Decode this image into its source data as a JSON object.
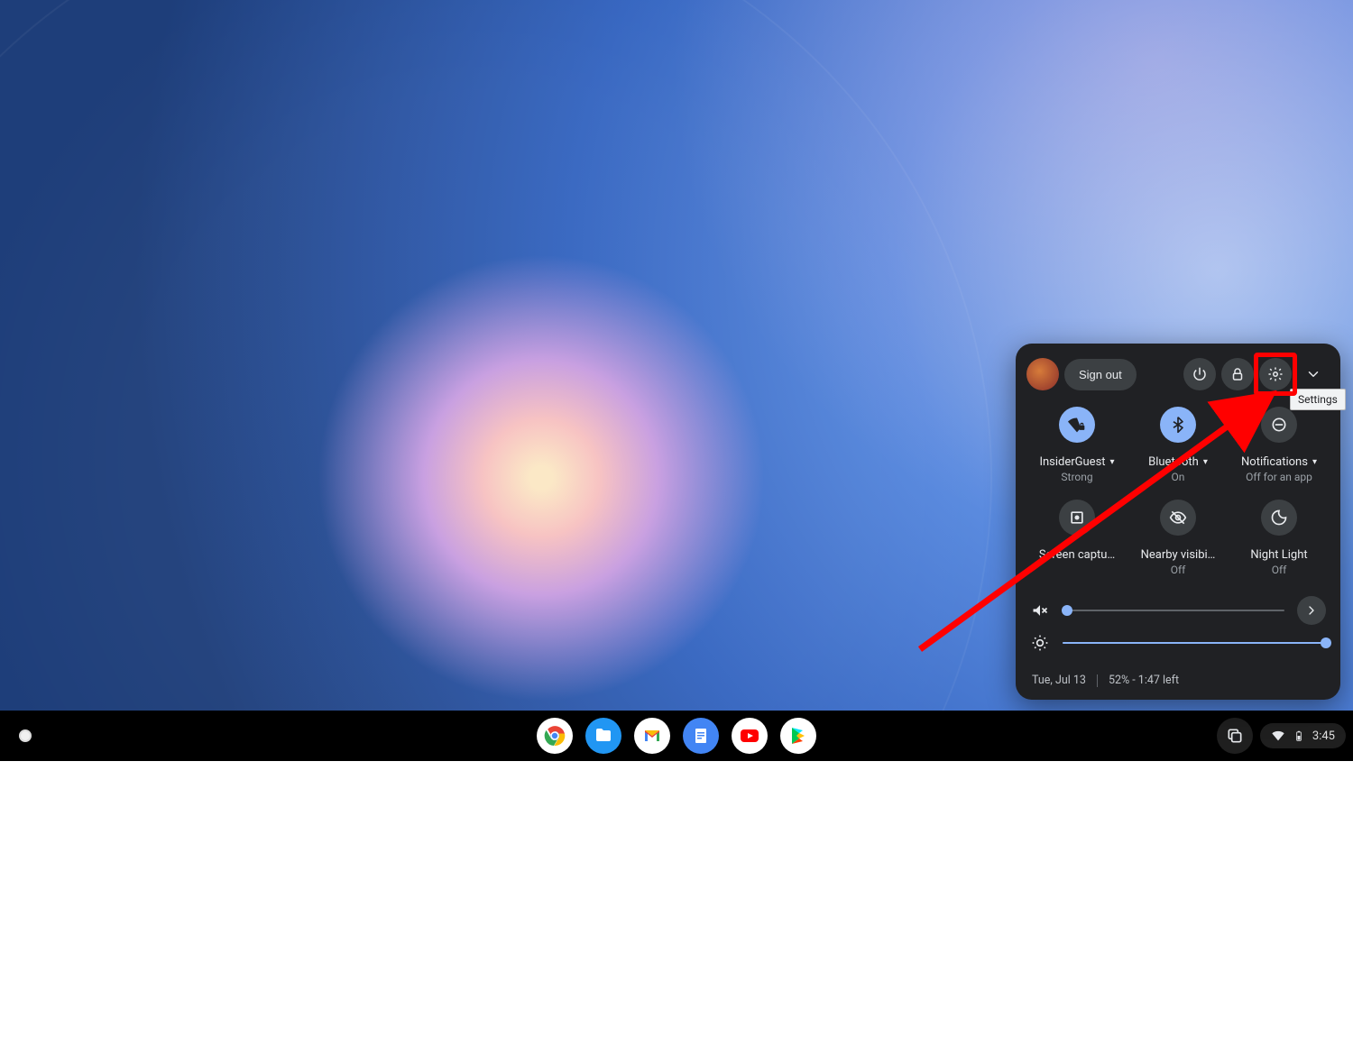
{
  "tooltip": {
    "settings": "Settings"
  },
  "qs": {
    "signout_label": "Sign out",
    "tiles": {
      "wifi": {
        "label": "InsiderGuest",
        "sub": "Strong"
      },
      "bluetooth": {
        "label": "Bluetooth",
        "sub": "On"
      },
      "notifications": {
        "label": "Notifications",
        "sub": "Off for an app"
      },
      "screencap": {
        "label": "Screen captu…",
        "sub": ""
      },
      "nearby": {
        "label": "Nearby visibi…",
        "sub": "Off"
      },
      "nightlight": {
        "label": "Night Light",
        "sub": "Off"
      }
    },
    "sliders": {
      "volume_pct": 2,
      "brightness_pct": 100
    },
    "footer": {
      "date": "Tue, Jul 13",
      "battery": "52% - 1:47 left"
    }
  },
  "status_area": {
    "time": "3:45"
  }
}
